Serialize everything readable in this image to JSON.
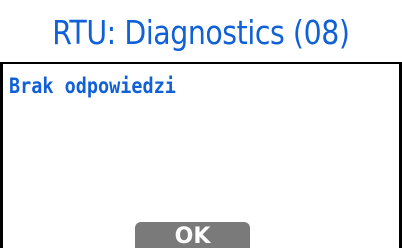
{
  "dialog": {
    "title": "RTU: Diagnostics (08)",
    "message": "Brak odpowiedzi",
    "ok_label": "OK"
  },
  "colors": {
    "accent_text": "#1060d8",
    "background": "#ffffff",
    "button": "#7a7a7a",
    "button_text": "#ffffff",
    "frame": "#000000"
  }
}
